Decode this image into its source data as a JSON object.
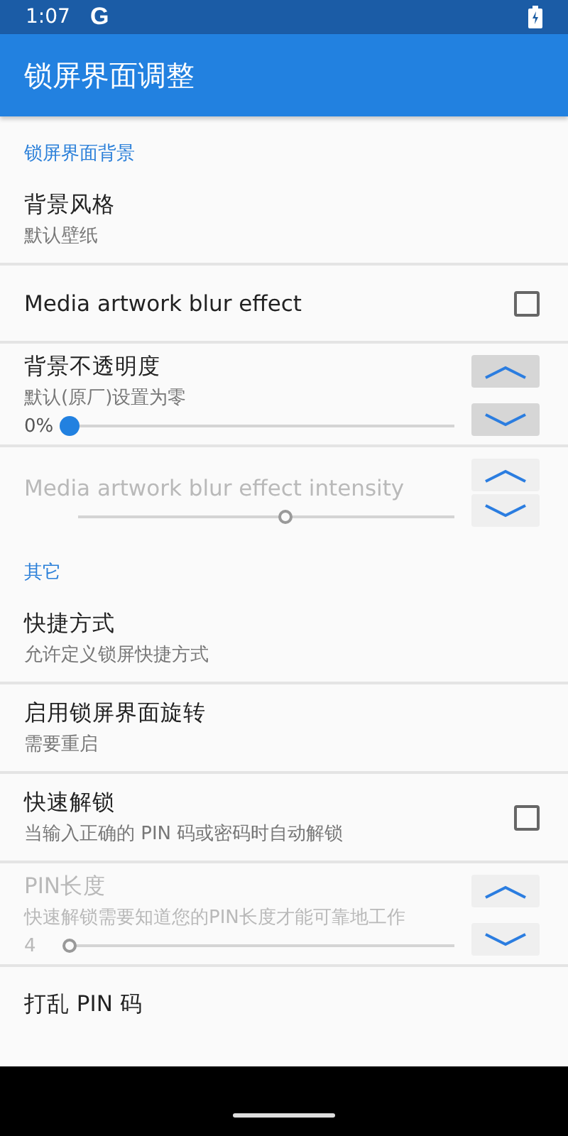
{
  "status_bar": {
    "time": "1:07",
    "g": "G"
  },
  "app_bar": {
    "title": "锁屏界面调整"
  },
  "items": [
    {
      "kind": "category",
      "title": "锁屏界面背景"
    },
    {
      "kind": "text",
      "title": "背景风格",
      "summary": "默认壁纸",
      "disabled": false
    },
    {
      "kind": "checkbox",
      "title": "Media artwork blur effect",
      "checked": false,
      "disabled": false
    },
    {
      "kind": "slider",
      "title": "背景不透明度",
      "summary": "默认(原厂)设置为零",
      "value": "0%",
      "level": 0,
      "disabled": false
    },
    {
      "kind": "slider",
      "title": "Media artwork blur effect intensity",
      "level": 0.55,
      "disabled": true
    },
    {
      "kind": "category",
      "title": "其它"
    },
    {
      "kind": "text",
      "title": "快捷方式",
      "summary": "允许定义锁屏快捷方式",
      "disabled": false
    },
    {
      "kind": "text",
      "title": "启用锁屏界面旋转",
      "summary": "需要重启",
      "disabled": false
    },
    {
      "kind": "checkbox",
      "title": "快速解锁",
      "summary": "当输入正确的 PIN 码或密码时自动解锁",
      "checked": false,
      "disabled": false
    },
    {
      "kind": "slider",
      "title": "PIN长度",
      "summary": "快速解锁需要知道您的PIN长度才能可靠地工作",
      "value": "4",
      "level": 0,
      "disabled": true
    },
    {
      "kind": "text",
      "title": "打乱 PIN 码",
      "disabled": false
    }
  ]
}
